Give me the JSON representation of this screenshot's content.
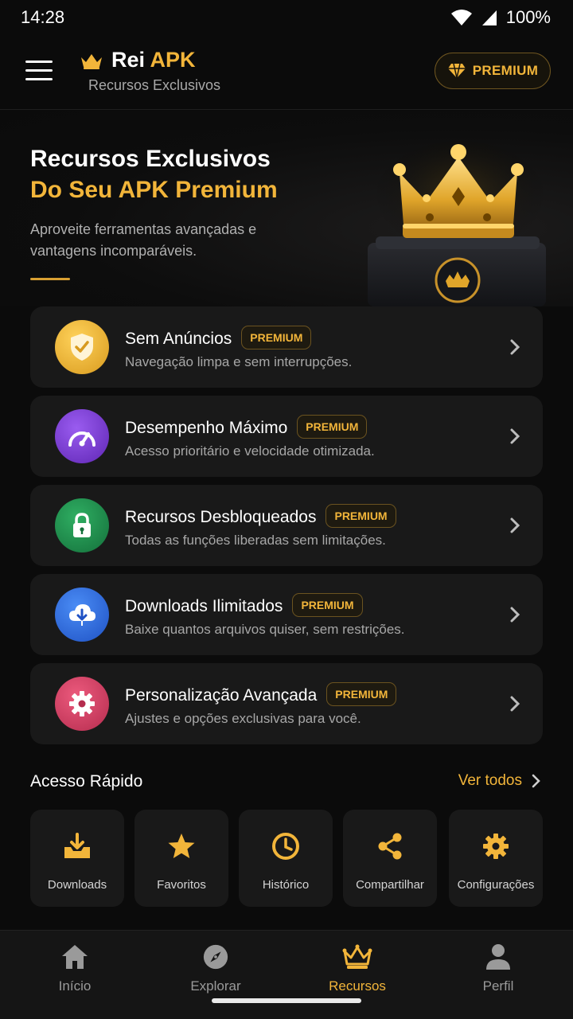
{
  "status": {
    "time": "14:28",
    "battery": "100%"
  },
  "appbar": {
    "title_main": "Rei",
    "title_accent": "APK",
    "subtitle": "Recursos Exclusivos",
    "premium_label": "PREMIUM"
  },
  "hero": {
    "title_line1": "Recursos Exclusivos",
    "title_line2": "Do Seu APK Premium",
    "description": "Aproveite ferramentas avançadas e vantagens incomparáveis."
  },
  "features": [
    {
      "title": "Sem Anúncios",
      "badge": "PREMIUM",
      "description": "Navegação limpa e sem interrupções.",
      "icon": "shield-check-icon",
      "color": "#f2b53a"
    },
    {
      "title": "Desempenho Máximo",
      "badge": "PREMIUM",
      "description": "Acesso prioritário e velocidade otimizada.",
      "icon": "speedometer-icon",
      "color": "#7b3fd1"
    },
    {
      "title": "Recursos Desbloqueados",
      "badge": "PREMIUM",
      "description": "Todas as funções liberadas sem limitações.",
      "icon": "lock-icon",
      "color": "#1e8a4c"
    },
    {
      "title": "Downloads Ilimitados",
      "badge": "PREMIUM",
      "description": "Baixe quantos arquivos quiser, sem restrições.",
      "icon": "cloud-download-icon",
      "color": "#2f6fe0"
    },
    {
      "title": "Personalização Avançada",
      "badge": "PREMIUM",
      "description": "Ajustes e opções exclusivas para você.",
      "icon": "gear-icon",
      "color": "#d43f63"
    }
  ],
  "quick": {
    "title": "Acesso Rápido",
    "see_all": "Ver todos",
    "items": [
      {
        "label": "Downloads",
        "icon": "download-tray-icon"
      },
      {
        "label": "Favoritos",
        "icon": "star-icon"
      },
      {
        "label": "Histórico",
        "icon": "clock-icon"
      },
      {
        "label": "Compartilhar",
        "icon": "share-icon"
      },
      {
        "label": "Configurações",
        "icon": "gear-icon"
      }
    ]
  },
  "nav": [
    {
      "label": "Início",
      "icon": "home-icon",
      "active": false
    },
    {
      "label": "Explorar",
      "icon": "compass-icon",
      "active": false
    },
    {
      "label": "Recursos",
      "icon": "crown-icon",
      "active": true
    },
    {
      "label": "Perfil",
      "icon": "person-icon",
      "active": false
    }
  ],
  "colors": {
    "accent": "#f2b53a",
    "background": "#0b0b0b",
    "card": "#191919"
  }
}
